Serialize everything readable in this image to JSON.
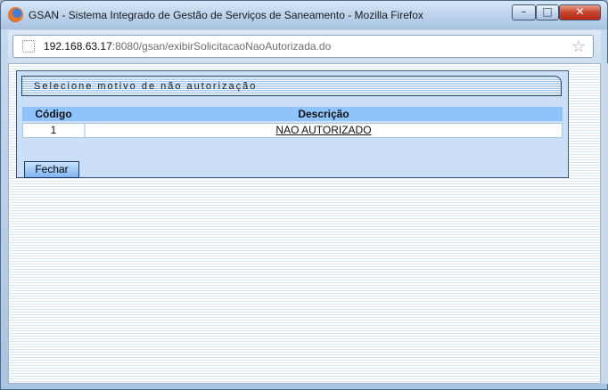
{
  "window": {
    "title": "GSAN - Sistema Integrado de Gestão de Serviços de Saneamento - Mozilla Firefox",
    "buttons": {
      "minimize": "–",
      "maximize": "□",
      "close": "✕"
    }
  },
  "address_bar": {
    "host": "192.168.63.17",
    "path": ":8080/gsan/exibirSolicitacaoNaoAutorizada.do",
    "star_icon": "☆"
  },
  "panel": {
    "title": "Selecione motivo de não autorização",
    "table": {
      "headers": {
        "code": "Código",
        "description": "Descrição"
      },
      "rows": [
        {
          "code": "1",
          "description": "NAO AUTORIZADO"
        }
      ]
    },
    "close_button": "Fechar"
  },
  "colors": {
    "table_header": "#8ec3fb",
    "panel_bg": "#cbe0f6",
    "close_button": "#c8432a"
  }
}
